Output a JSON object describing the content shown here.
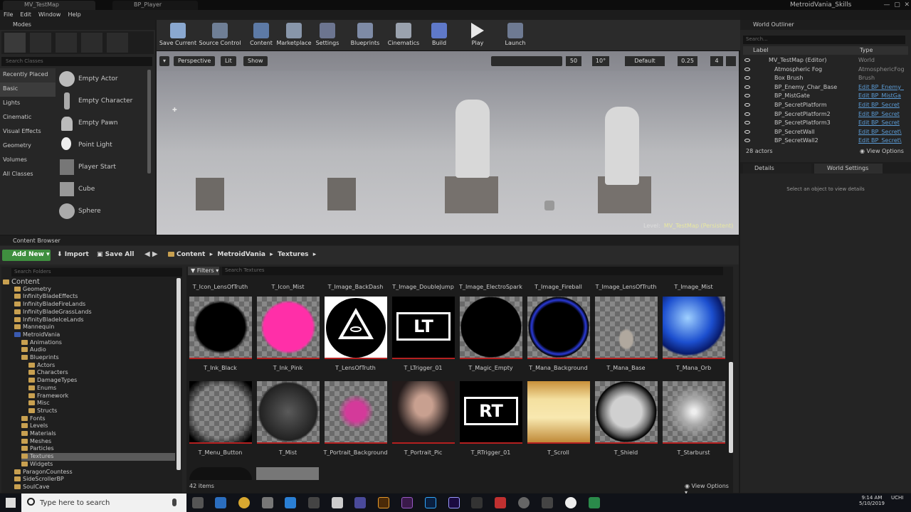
{
  "window": {
    "tabs": [
      "MV_TestMap",
      "BP_Player"
    ],
    "project": "MetroidVania_Skills"
  },
  "menu": [
    "File",
    "Edit",
    "Window",
    "Help"
  ],
  "modes": {
    "title": "Modes",
    "search_placeholder": "Search Classes",
    "categories": [
      "Recently Placed",
      "Basic",
      "Lights",
      "Cinematic",
      "Visual Effects",
      "Geometry",
      "Volumes",
      "All Classes"
    ],
    "items": [
      "Empty Actor",
      "Empty Character",
      "Empty Pawn",
      "Point Light",
      "Player Start",
      "Cube",
      "Sphere"
    ]
  },
  "toolbar": [
    "Save Current",
    "Source Control",
    "Content",
    "Marketplace",
    "Settings",
    "Blueprints",
    "Cinematics",
    "Build",
    "Play",
    "Launch"
  ],
  "viewport": {
    "perspective": "Perspective",
    "lit": "Lit",
    "show": "Show",
    "grid": "50",
    "angle": "10°",
    "mode": "Default",
    "scale": "0.25",
    "cam": "4",
    "level_label": "Level:",
    "level_name": "MV_TestMap (Persistent)"
  },
  "outliner": {
    "title": "World Outliner",
    "search_placeholder": "Search...",
    "col_label": "Label",
    "col_type": "Type",
    "rows": [
      {
        "label": "MV_TestMap (Editor)",
        "type": "World",
        "link": false
      },
      {
        "label": "Atmospheric Fog",
        "type": "AtmosphericFog",
        "link": false
      },
      {
        "label": "Box Brush",
        "type": "Brush",
        "link": false
      },
      {
        "label": "BP_Enemy_Char_Base",
        "type": "Edit BP_Enemy_",
        "link": true
      },
      {
        "label": "BP_MistGate",
        "type": "Edit BP_MistGa",
        "link": true
      },
      {
        "label": "BP_SecretPlatform",
        "type": "Edit BP_Secret",
        "link": true
      },
      {
        "label": "BP_SecretPlatform2",
        "type": "Edit BP_Secret",
        "link": true
      },
      {
        "label": "BP_SecretPlatform3",
        "type": "Edit BP_Secret",
        "link": true
      },
      {
        "label": "BP_SecretWall",
        "type": "Edit BP_Secret\\",
        "link": true
      },
      {
        "label": "BP_SecretWall2",
        "type": "Edit BP_Secret\\",
        "link": true
      }
    ],
    "count": "28 actors",
    "view_options": "View Options"
  },
  "details": {
    "tab1": "Details",
    "tab2": "World Settings",
    "empty": "Select an object to view details"
  },
  "content_browser": {
    "title": "Content Browser",
    "add_new": "Add New",
    "import": "Import",
    "save_all": "Save All",
    "path": [
      "Content",
      "MetroidVania",
      "Textures"
    ],
    "search_folders": "Search Folders",
    "filters": "Filters",
    "search_textures": "Search Textures",
    "tree": [
      {
        "name": "Content",
        "depth": 0
      },
      {
        "name": "Geometry",
        "depth": 1
      },
      {
        "name": "InfinityBladeEffects",
        "depth": 1
      },
      {
        "name": "InfinityBladeFireLands",
        "depth": 1
      },
      {
        "name": "InfinityBladeGrassLands",
        "depth": 1
      },
      {
        "name": "InfinityBladeIceLands",
        "depth": 1
      },
      {
        "name": "Mannequin",
        "depth": 1
      },
      {
        "name": "MetroidVania",
        "depth": 1
      },
      {
        "name": "Animations",
        "depth": 2
      },
      {
        "name": "Audio",
        "depth": 2
      },
      {
        "name": "Blueprints",
        "depth": 2
      },
      {
        "name": "Actors",
        "depth": 3
      },
      {
        "name": "Characters",
        "depth": 3
      },
      {
        "name": "DamageTypes",
        "depth": 3
      },
      {
        "name": "Enums",
        "depth": 3
      },
      {
        "name": "Framework",
        "depth": 3
      },
      {
        "name": "Misc",
        "depth": 3
      },
      {
        "name": "Structs",
        "depth": 3
      },
      {
        "name": "Fonts",
        "depth": 2
      },
      {
        "name": "Levels",
        "depth": 2
      },
      {
        "name": "Materials",
        "depth": 2
      },
      {
        "name": "Meshes",
        "depth": 2
      },
      {
        "name": "Particles",
        "depth": 2
      },
      {
        "name": "Textures",
        "depth": 2
      },
      {
        "name": "Widgets",
        "depth": 2
      },
      {
        "name": "ParagonCountess",
        "depth": 1
      },
      {
        "name": "SideScrollerBP",
        "depth": 1
      },
      {
        "name": "SoulCave",
        "depth": 1
      }
    ],
    "top_labels": [
      "T_Icon_LensOfTruth",
      "T_Icon_Mist",
      "T_Image_BackDash",
      "T_Image_DoubleJump",
      "T_Image_ElectroSpark",
      "T_Image_Fireball",
      "T_Image_LensOfTruth",
      "T_Image_Mist"
    ],
    "row1": [
      "T_Ink_Black",
      "T_Ink_Pink",
      "T_LensOfTruth",
      "T_LTrigger_01",
      "T_Magic_Empty",
      "T_Mana_Background",
      "T_Mana_Base",
      "T_Mana_Orb"
    ],
    "row2": [
      "T_Menu_Button",
      "T_Mist",
      "T_Portrait_Background",
      "T_Portrait_Pic",
      "T_RTrigger_01",
      "T_Scroll",
      "T_Shield",
      "T_Starburst"
    ],
    "lt": "LT",
    "rt": "RT",
    "count": "42 items",
    "view_options": "View Options"
  },
  "taskbar": {
    "search": "Type here to search",
    "time": "9:14 AM",
    "date": "5/10/2019",
    "user": "UCHI"
  }
}
